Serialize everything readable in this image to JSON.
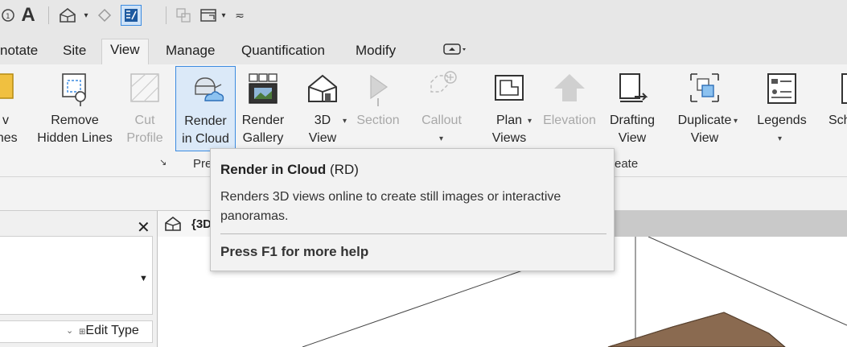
{
  "quick_access": {
    "items": [
      {
        "icon": "measure-icon"
      },
      {
        "icon": "text-icon",
        "glyph": "A"
      },
      {
        "icon": "3d-view-icon"
      },
      {
        "icon": "section-icon"
      },
      {
        "icon": "thin-lines-icon"
      },
      {
        "icon": "close-hidden-icon"
      },
      {
        "icon": "switch-windows-icon"
      },
      {
        "icon": "customize-icon"
      }
    ]
  },
  "tabs": {
    "annotate": "notate",
    "site": "Site",
    "view": "View",
    "manage": "Manage",
    "quantification": "Quantification",
    "modify": "Modify"
  },
  "ribbon": {
    "thin_lines": {
      "line1": "v",
      "line2": "ines"
    },
    "remove_hidden": {
      "line1": "Remove",
      "line2": "Hidden Lines"
    },
    "cut_profile": {
      "line1": "Cut",
      "line2": "Profile"
    },
    "render_cloud": {
      "line1": "Render",
      "line2": "in Cloud"
    },
    "render_gallery": {
      "line1": "Render",
      "line2": "Gallery"
    },
    "view3d": {
      "line1": "3D",
      "line2": "View"
    },
    "section": {
      "line1": "Section"
    },
    "callout": {
      "line1": "Callout"
    },
    "plan_views": {
      "line1": "Plan",
      "line2": "Views"
    },
    "elevation": {
      "line1": "Elevation"
    },
    "drafting_view": {
      "line1": "Drafting",
      "line2": "View"
    },
    "duplicate_view": {
      "line1": "Duplicate",
      "line2": "View"
    },
    "legends": {
      "line1": "Legends"
    },
    "schedules": {
      "line1": "Sch"
    }
  },
  "panels": {
    "presentation": "Pre",
    "create": "reate",
    "launcher_glyph": "↘"
  },
  "properties": {
    "close_glyph": "✕",
    "edit_type": "Edit Type"
  },
  "view_tab": {
    "label": "{3D"
  },
  "tooltip": {
    "title": "Render in Cloud",
    "shortcut": "(RD)",
    "description": "Renders 3D views online to create still images or interactive panoramas.",
    "help": "Press F1 for more help"
  },
  "colors": {
    "accent": "#3c8be0",
    "selected_bg": "#dbe9f8",
    "roof": "#8a6a50"
  }
}
